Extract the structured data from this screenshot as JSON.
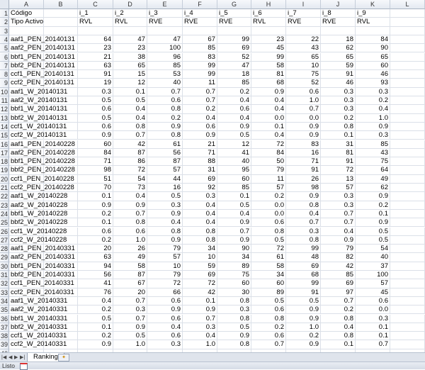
{
  "columns": [
    "A",
    "B",
    "C",
    "D",
    "E",
    "F",
    "G",
    "H",
    "I",
    "J",
    "K",
    "L"
  ],
  "header_rows": [
    {
      "A": "Código",
      "B": "",
      "C": "i_1",
      "D": "i_2",
      "E": "i_3",
      "F": "i_4",
      "G": "i_5",
      "H": "i_6",
      "I": "i_7",
      "J": "i_8",
      "K": "i_9"
    },
    {
      "A": "Tipo Activo",
      "B": "",
      "C": "RVL",
      "D": "RVL",
      "E": "RVE",
      "F": "RVE",
      "G": "RVE",
      "H": "RVL",
      "I": "RVE",
      "J": "RVE",
      "K": "RVL"
    }
  ],
  "rows": [
    {
      "code": "aaf1_PEN_20140131",
      "values": [
        "64",
        "47",
        "47",
        "67",
        "99",
        "23",
        "22",
        "18",
        "84"
      ]
    },
    {
      "code": "aaf2_PEN_20140131",
      "values": [
        "23",
        "23",
        "100",
        "85",
        "69",
        "45",
        "43",
        "62",
        "90"
      ]
    },
    {
      "code": "bbf1_PEN_20140131",
      "values": [
        "21",
        "38",
        "96",
        "83",
        "52",
        "99",
        "65",
        "65",
        "65"
      ]
    },
    {
      "code": "bbf2_PEN_20140131",
      "values": [
        "63",
        "65",
        "85",
        "99",
        "47",
        "58",
        "10",
        "59",
        "60"
      ]
    },
    {
      "code": "ccf1_PEN_20140131",
      "values": [
        "91",
        "15",
        "53",
        "99",
        "18",
        "81",
        "75",
        "91",
        "46"
      ]
    },
    {
      "code": "ccf2_PEN_20140131",
      "values": [
        "19",
        "12",
        "40",
        "11",
        "85",
        "68",
        "52",
        "46",
        "93"
      ]
    },
    {
      "code": "aaf1_W_20140131",
      "values": [
        "0.3",
        "0.1",
        "0.7",
        "0.7",
        "0.2",
        "0.9",
        "0.6",
        "0.3",
        "0.3"
      ]
    },
    {
      "code": "aaf2_W_20140131",
      "values": [
        "0.5",
        "0.5",
        "0.6",
        "0.7",
        "0.4",
        "0.4",
        "1.0",
        "0.3",
        "0.2"
      ]
    },
    {
      "code": "bbf1_W_20140131",
      "values": [
        "0.6",
        "0.4",
        "0.8",
        "0.2",
        "0.6",
        "0.4",
        "0.7",
        "0.3",
        "0.4"
      ]
    },
    {
      "code": "bbf2_W_20140131",
      "values": [
        "0.5",
        "0.4",
        "0.2",
        "0.4",
        "0.4",
        "0.0",
        "0.0",
        "0.2",
        "1.0"
      ]
    },
    {
      "code": "ccf1_W_20140131",
      "values": [
        "0.6",
        "0.8",
        "0.9",
        "0.6",
        "0.9",
        "0.1",
        "0.9",
        "0.8",
        "0.9"
      ]
    },
    {
      "code": "ccf2_W_20140131",
      "values": [
        "0.9",
        "0.7",
        "0.8",
        "0.9",
        "0.5",
        "0.4",
        "0.9",
        "0.1",
        "0.3"
      ]
    },
    {
      "code": "aaf1_PEN_20140228",
      "values": [
        "60",
        "42",
        "61",
        "21",
        "12",
        "72",
        "83",
        "31",
        "85"
      ]
    },
    {
      "code": "aaf2_PEN_20140228",
      "values": [
        "84",
        "87",
        "56",
        "71",
        "41",
        "84",
        "16",
        "81",
        "43"
      ]
    },
    {
      "code": "bbf1_PEN_20140228",
      "values": [
        "71",
        "86",
        "87",
        "88",
        "40",
        "50",
        "71",
        "91",
        "75"
      ]
    },
    {
      "code": "bbf2_PEN_20140228",
      "values": [
        "98",
        "72",
        "57",
        "31",
        "95",
        "79",
        "91",
        "72",
        "64"
      ]
    },
    {
      "code": "ccf1_PEN_20140228",
      "values": [
        "51",
        "54",
        "44",
        "69",
        "60",
        "11",
        "26",
        "13",
        "49"
      ]
    },
    {
      "code": "ccf2_PEN_20140228",
      "values": [
        "70",
        "73",
        "16",
        "92",
        "85",
        "57",
        "98",
        "57",
        "62"
      ]
    },
    {
      "code": "aaf1_W_20140228",
      "values": [
        "0.1",
        "0.4",
        "0.5",
        "0.3",
        "0.1",
        "0.2",
        "0.9",
        "0.3",
        "0.9"
      ]
    },
    {
      "code": "aaf2_W_20140228",
      "values": [
        "0.9",
        "0.9",
        "0.3",
        "0.4",
        "0.5",
        "0.0",
        "0.8",
        "0.3",
        "0.2"
      ]
    },
    {
      "code": "bbf1_W_20140228",
      "values": [
        "0.2",
        "0.7",
        "0.9",
        "0.4",
        "0.4",
        "0.0",
        "0.4",
        "0.7",
        "0.1"
      ]
    },
    {
      "code": "bbf2_W_20140228",
      "values": [
        "0.1",
        "0.8",
        "0.4",
        "0.4",
        "0.9",
        "0.6",
        "0.7",
        "0.7",
        "0.9"
      ]
    },
    {
      "code": "ccf1_W_20140228",
      "values": [
        "0.6",
        "0.6",
        "0.8",
        "0.8",
        "0.7",
        "0.8",
        "0.3",
        "0.4",
        "0.5"
      ]
    },
    {
      "code": "ccf2_W_20140228",
      "values": [
        "0.2",
        "1.0",
        "0.9",
        "0.8",
        "0.9",
        "0.5",
        "0.8",
        "0.9",
        "0.5"
      ]
    },
    {
      "code": "aaf1_PEN_20140331",
      "values": [
        "20",
        "26",
        "79",
        "34",
        "90",
        "72",
        "99",
        "79",
        "54"
      ]
    },
    {
      "code": "aaf2_PEN_20140331",
      "values": [
        "63",
        "49",
        "57",
        "10",
        "34",
        "61",
        "48",
        "82",
        "40"
      ]
    },
    {
      "code": "bbf1_PEN_20140331",
      "values": [
        "94",
        "58",
        "10",
        "59",
        "89",
        "58",
        "69",
        "42",
        "37"
      ]
    },
    {
      "code": "bbf2_PEN_20140331",
      "values": [
        "56",
        "87",
        "79",
        "69",
        "75",
        "34",
        "68",
        "85",
        "100"
      ]
    },
    {
      "code": "ccf1_PEN_20140331",
      "values": [
        "41",
        "67",
        "72",
        "72",
        "60",
        "60",
        "99",
        "69",
        "57"
      ]
    },
    {
      "code": "ccf2_PEN_20140331",
      "values": [
        "76",
        "20",
        "66",
        "42",
        "30",
        "89",
        "91",
        "97",
        "45"
      ]
    },
    {
      "code": "aaf1_W_20140331",
      "values": [
        "0.4",
        "0.7",
        "0.6",
        "0.1",
        "0.8",
        "0.5",
        "0.5",
        "0.7",
        "0.6"
      ]
    },
    {
      "code": "aaf2_W_20140331",
      "values": [
        "0.2",
        "0.3",
        "0.9",
        "0.9",
        "0.3",
        "0.6",
        "0.9",
        "0.2",
        "0.0"
      ]
    },
    {
      "code": "bbf1_W_20140331",
      "values": [
        "0.5",
        "0.7",
        "0.6",
        "0.7",
        "0.8",
        "0.8",
        "0.9",
        "0.8",
        "0.3"
      ]
    },
    {
      "code": "bbf2_W_20140331",
      "values": [
        "0.1",
        "0.9",
        "0.4",
        "0.3",
        "0.5",
        "0.2",
        "1.0",
        "0.4",
        "0.1"
      ]
    },
    {
      "code": "ccf1_W_20140331",
      "values": [
        "0.2",
        "0.5",
        "0.6",
        "0.4",
        "0.9",
        "0.6",
        "0.2",
        "0.8",
        "0.1"
      ]
    },
    {
      "code": "ccf2_W_20140331",
      "values": [
        "0.9",
        "1.0",
        "0.3",
        "1.0",
        "0.8",
        "0.7",
        "0.9",
        "0.1",
        "0.7"
      ]
    }
  ],
  "sheet_tabs": [
    {
      "label": "Ranking",
      "active": true
    }
  ],
  "status": {
    "text": "Listo"
  },
  "colors": {
    "gridline": "#dbe0e8",
    "header_bg": "#e4e9f1",
    "tabbar_bg": "#dfe4ec"
  }
}
